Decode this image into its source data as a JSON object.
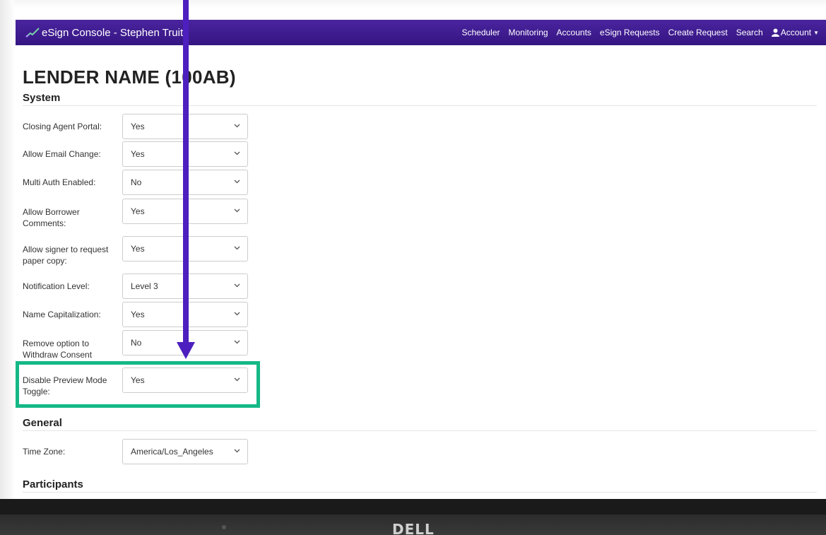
{
  "navbar": {
    "title": "eSign Console - Stephen Truitt",
    "items": [
      "Scheduler",
      "Monitoring",
      "Accounts",
      "eSign Requests",
      "Create Request",
      "Search"
    ],
    "account_label": "Account"
  },
  "page": {
    "lender_title": "LENDER NAME (100AB)"
  },
  "sections": {
    "system": "System",
    "general": "General",
    "participants": "Participants"
  },
  "system_fields": [
    {
      "label": "Closing Agent Portal:",
      "value": "Yes"
    },
    {
      "label": "Allow Email Change:",
      "value": "Yes"
    },
    {
      "label": "Multi Auth Enabled:",
      "value": "No"
    },
    {
      "label": "Allow Borrower Comments:",
      "value": "Yes"
    },
    {
      "label": "Allow signer to request paper copy:",
      "value": "Yes"
    },
    {
      "label": "Notification Level:",
      "value": "Level 3"
    },
    {
      "label": "Name Capitalization:",
      "value": "Yes"
    },
    {
      "label": "Remove option to Withdraw Consent",
      "value": "No"
    },
    {
      "label": "Disable Preview Mode Toggle:",
      "value": "Yes"
    }
  ],
  "general_fields": [
    {
      "label": "Time Zone:",
      "value": "America/Los_Angeles"
    }
  ],
  "annotation": {
    "highlight_color": "#14b886",
    "arrow_color": "#4d1fbf"
  },
  "bezel": {
    "brand": "DELL"
  }
}
